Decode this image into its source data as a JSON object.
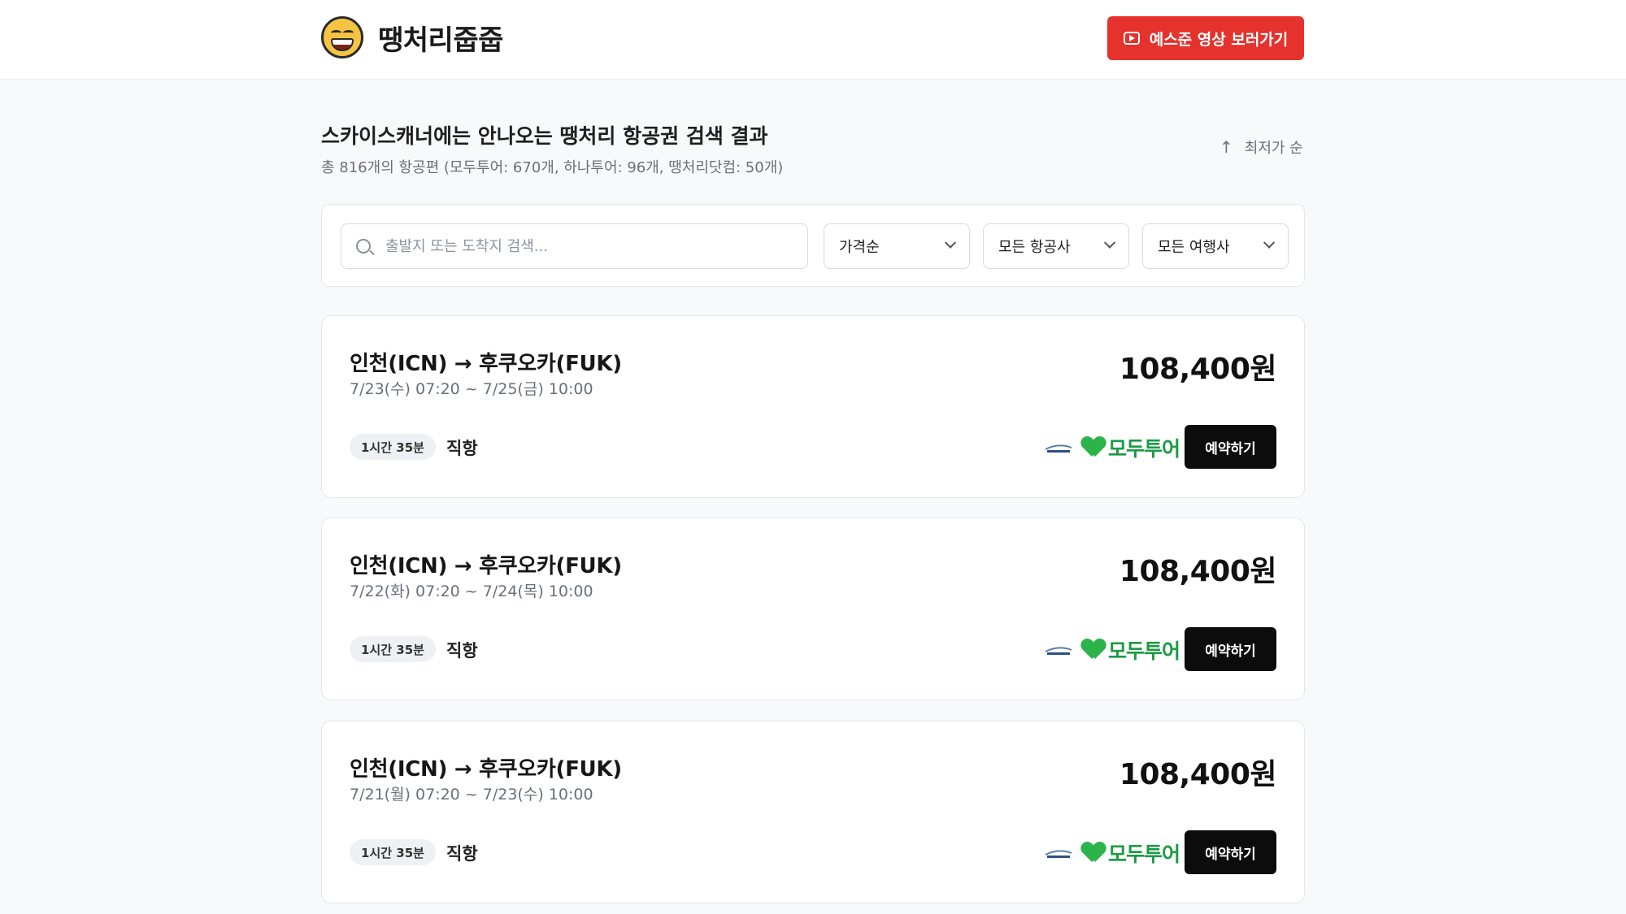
{
  "header": {
    "brand": "땡처리줍줍",
    "video_button": "예스준 영상 보러가기"
  },
  "summary": {
    "title": "스카이스캐너에는 안나오는 땡처리 항공권 검색 결과",
    "subtitle": "총 816개의 항공편 (모두투어: 670개, 하나투어: 96개, 땡처리닷컴: 50개)",
    "sort_link": "최저가 순"
  },
  "filters": {
    "search_placeholder": "출발지 또는 도착지 검색...",
    "sort_select": "가격순",
    "airline_select": "모든 항공사",
    "agency_select": "모든 여행사"
  },
  "flights": [
    {
      "route": "인천(ICN) → 후쿠오카(FUK)",
      "dates": "7/23(수) 07:20 ~ 7/25(금) 10:00",
      "price": "108,400원",
      "duration": "1시간 35분",
      "type": "직항",
      "agency": "모두투어",
      "book": "예약하기"
    },
    {
      "route": "인천(ICN) → 후쿠오카(FUK)",
      "dates": "7/22(화) 07:20 ~ 7/24(목) 10:00",
      "price": "108,400원",
      "duration": "1시간 35분",
      "type": "직항",
      "agency": "모두투어",
      "book": "예약하기"
    },
    {
      "route": "인천(ICN) → 후쿠오카(FUK)",
      "dates": "7/21(월) 07:20 ~ 7/23(수) 10:00",
      "price": "108,400원",
      "duration": "1시간 35분",
      "type": "직항",
      "agency": "모두투어",
      "book": "예약하기"
    }
  ],
  "colors": {
    "accent_red": "#e5322d",
    "agency_green": "#2cb34a"
  }
}
